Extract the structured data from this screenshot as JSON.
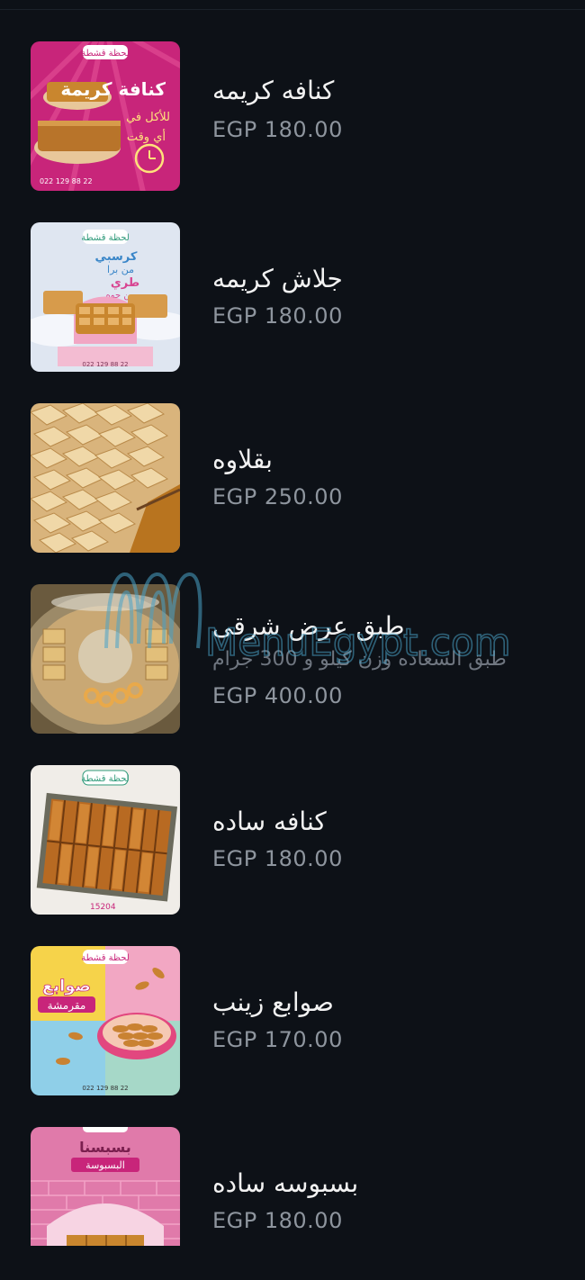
{
  "menu": {
    "items": [
      {
        "name": "كنافه كريمه",
        "price": "EGP 180.00",
        "image": "kunafa-cream-promo"
      },
      {
        "name": "جلاش كريمه",
        "price": "EGP 180.00",
        "image": "gullash-cream-promo"
      },
      {
        "name": "بقلاوه",
        "price": "EGP 250.00",
        "image": "baklava-tray-photo"
      },
      {
        "name": "طبق عرض شرقى",
        "description": "طبق السعاده وزن كيلو و 300 جرام",
        "price": "EGP 400.00",
        "image": "oriental-display-plate-photo"
      },
      {
        "name": "كنافه ساده",
        "price": "EGP 180.00",
        "image": "plain-kunafa-box-photo"
      },
      {
        "name": "صوابع زينب",
        "price": "EGP 170.00",
        "image": "zainab-fingers-promo"
      },
      {
        "name": "بسبوسه ساده",
        "price": "EGP 180.00",
        "image": "plain-basbousa-promo"
      }
    ]
  },
  "thumb_texts": {
    "brand": "لحظة قشطة",
    "phone": "022 129 88 22",
    "kunafa_title": "كنافة كريمة",
    "kunafa_sub1": "للأكل في",
    "kunafa_sub2": "أي وقت",
    "gullash_title1": "كرسبي",
    "gullash_title2": "من برا",
    "gullash_title3": "طري",
    "gullash_title4": "من جوه",
    "box_code": "15204",
    "fingers_title1": "صوابع",
    "fingers_title2": "مقرمشة",
    "basbousa_title1": "بسبسنا",
    "basbousa_title2": "البسبوسة"
  },
  "watermark": {
    "text": "MenuEgypt.com",
    "color": "#4aa3c8"
  },
  "colors": {
    "background": "#0d1117",
    "name_text": "#f2f2f2",
    "price_text": "#8e959e",
    "magenta": "#c8257a",
    "pink": "#f2a7c3",
    "yellow": "#f6d34a",
    "teal": "#7bc4b8"
  }
}
